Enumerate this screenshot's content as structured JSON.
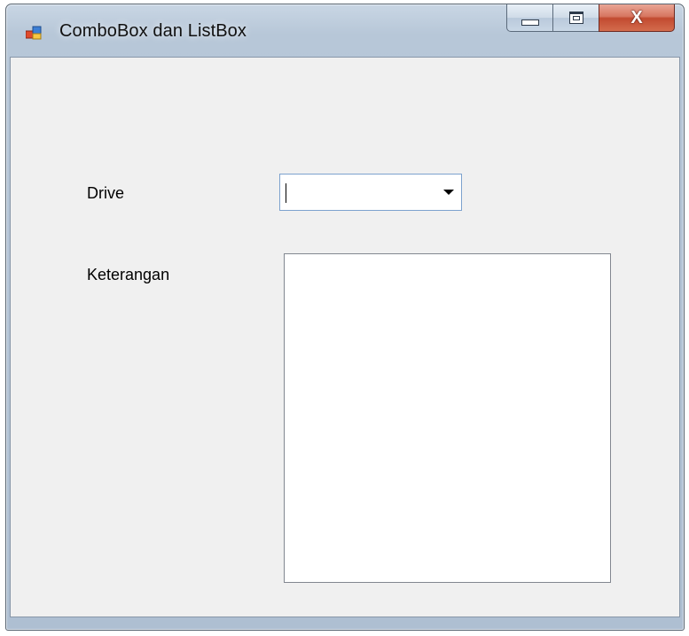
{
  "window": {
    "title": "ComboBox dan ListBox",
    "icon": "winforms-app-icon",
    "buttons": {
      "minimize": "minimize-icon",
      "maximize": "maximize-icon",
      "close": "close-icon"
    }
  },
  "form": {
    "drive_label": "Drive",
    "drive_combo_value": "",
    "keterangan_label": "Keterangan",
    "listbox_items": []
  },
  "colors": {
    "client_background": "#f0f0f0",
    "close_button": "#c24a30",
    "combo_focus_border": "#7da2ce"
  }
}
